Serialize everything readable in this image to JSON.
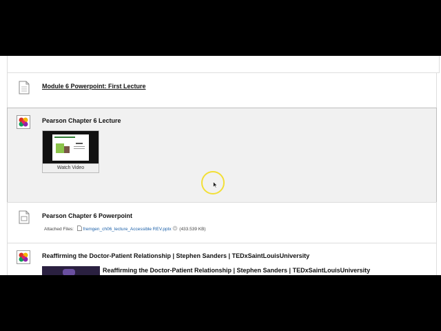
{
  "items": [
    {
      "title": "Module 6 Powerpoint: First Lecture",
      "icon": "document-icon"
    },
    {
      "title": "Pearson Chapter 6 Lecture",
      "icon": "mashup-media-icon",
      "video_button": "Watch Video"
    },
    {
      "title": "Pearson Chapter 6 Powerpoint",
      "icon": "document-icon",
      "attached_label": "Attached Files:",
      "file_name": "fremgen_ch06_lecture_Accessible REV.pptx",
      "file_size": "(433.539 KB)"
    },
    {
      "title": "Reaffirming the Doctor-Patient Relationship | Stephen Sanders | TEDxSaintLouisUniversity",
      "icon": "mashup-media-icon",
      "video_title": "Reaffirming the Doctor-Patient Relationship | Stephen Sanders | TEDxSaintLouisUniversity"
    }
  ],
  "colors": {
    "highlight_bg": "#f1f1f1",
    "link": "#1a5fa8",
    "cursor_ring": "#f2df36"
  }
}
